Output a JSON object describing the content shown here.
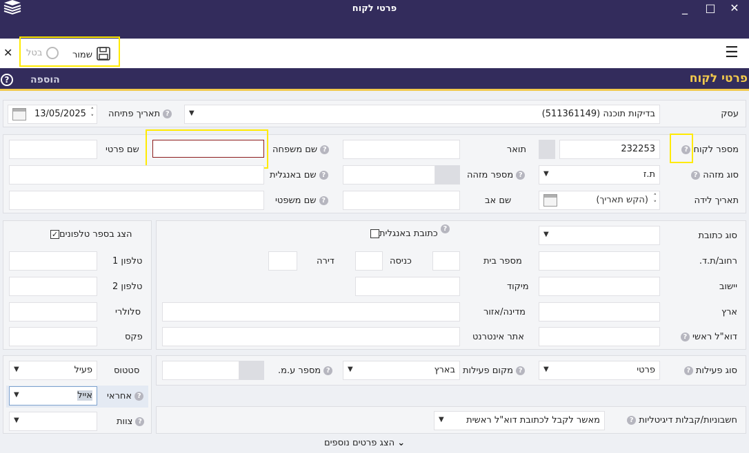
{
  "window": {
    "title": "פרטי לקוח",
    "minimize": "_",
    "maximize": "□",
    "close": "✕"
  },
  "toolbar": {
    "save_label": "שמור",
    "cancel_label": "בטל",
    "close_x": "✕",
    "menu_icon": "☰"
  },
  "section": {
    "title": "פרטי לקוח",
    "add_label": "הוספה",
    "help_icon": "?"
  },
  "header": {
    "business_label": "עסק",
    "business_value": "בדיקות תוכנה (511361149)",
    "open_date_label": "תאריך פתיחה",
    "open_date_value": "13/05/2025"
  },
  "personal": {
    "customer_number_label": "מספר לקוח",
    "customer_number_value": "232253",
    "title_label": "תואר",
    "title_value": "",
    "last_name_label": "שם משפחה",
    "last_name_value": "",
    "first_name_label": "שם פרטי",
    "first_name_value": "",
    "id_type_label": "סוג מזהה",
    "id_type_value": "ת.ז",
    "id_number_label": "מספר מזהה",
    "id_number_value": "",
    "english_name_label": "שם באנגלית",
    "english_name_value": "",
    "birth_date_label": "תאריך לידה",
    "birth_date_placeholder": "(הקש תאריך)",
    "father_name_label": "שם אב",
    "father_name_value": "",
    "legal_name_label": "שם משפטי",
    "legal_name_value": ""
  },
  "address": {
    "address_type_label": "סוג כתובת",
    "address_type_value": "",
    "english_address_label": "כתובת באנגלית",
    "street_label": "רחוב/ת.ד.",
    "house_number_label": "מספר בית",
    "entrance_label": "כניסה",
    "apartment_label": "דירה",
    "city_label": "יישוב",
    "zip_label": "מיקוד",
    "country_label": "ארץ",
    "state_label": "מדינה/אזור",
    "email_label": "דוא\"ל ראשי",
    "website_label": "אתר אינטרנט"
  },
  "phones": {
    "show_in_phonebook_label": "הצג בספר טלפונים",
    "phone1_label": "טלפון 1",
    "phone2_label": "טלפון 2",
    "mobile_label": "סלולרי",
    "fax_label": "פקס"
  },
  "activity": {
    "activity_type_label": "סוג פעילות",
    "activity_type_value": "פרטי",
    "activity_place_label": "מקום פעילות",
    "activity_place_value": "בארץ",
    "vat_number_label": "מספר ע.מ.",
    "vat_number_value": ""
  },
  "status": {
    "status_label": "סטטוס",
    "status_value": "פעיל",
    "responsible_label": "אחראי",
    "responsible_value": "אייל",
    "team_label": "צוות",
    "team_value": ""
  },
  "digital": {
    "invoices_label": "חשבוניות/קבלות דיגיטליות",
    "invoices_value": "מאשר לקבל לכתובת דוא\"ל ראשית"
  },
  "footer": {
    "more_details_label": "הצג פרטים נוספים"
  },
  "colors": {
    "header_bg": "#332c5c",
    "accent": "#f2c94c",
    "highlight": "#ffea00",
    "error_border": "#8b1a1a"
  }
}
